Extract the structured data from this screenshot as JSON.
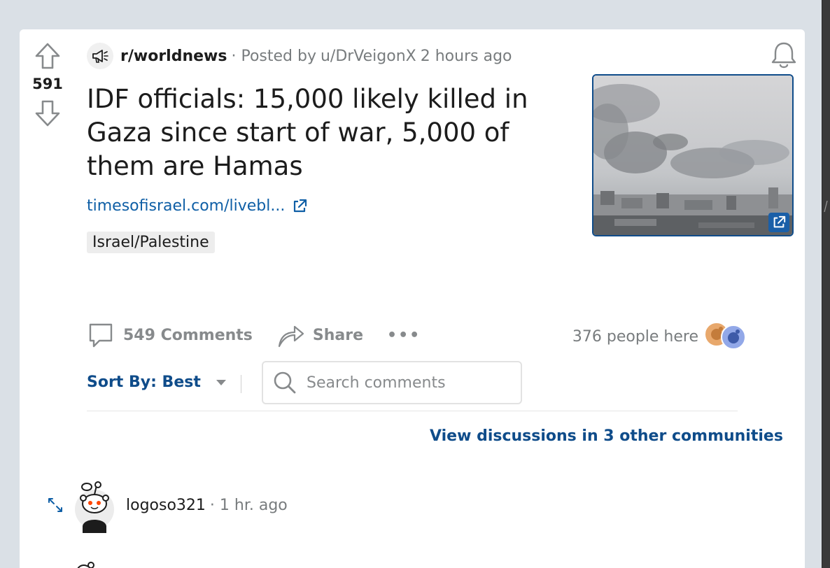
{
  "post": {
    "score": "591",
    "subreddit": "r/worldnews",
    "meta_prefix": "· Posted by",
    "author": "u/DrVeigonX",
    "time": "2 hours ago",
    "title": "IDF officials: 15,000 likely killed in Gaza since start of war, 5,000 of them are Hamas",
    "link_text": "timesofisrael.com/livebl...",
    "flair": "Israel/Palestine"
  },
  "actions": {
    "comments_label": "549 Comments",
    "share_label": "Share",
    "more_label": "•••",
    "online_text": "376 people here"
  },
  "comments_bar": {
    "sort_label": "Sort By: Best",
    "search_placeholder": "Search comments",
    "other_discussions": "View discussions in 3 other communities"
  },
  "first_comment": {
    "username": "logoso321",
    "time": "· 1 hr. ago"
  },
  "icons": {
    "upvote": "upvote-arrow-icon",
    "downvote": "downvote-arrow-icon",
    "subreddit": "megaphone-icon",
    "bell": "bell-icon",
    "external": "external-link-icon",
    "comment": "comment-bubble-icon",
    "share": "share-arrow-icon",
    "search": "search-icon",
    "caret": "caret-down-icon",
    "expand": "expand-arrows-icon"
  },
  "colors": {
    "link_blue": "#0f4c8a",
    "meta_gray": "#787c7e",
    "background": "#dae0e6"
  }
}
